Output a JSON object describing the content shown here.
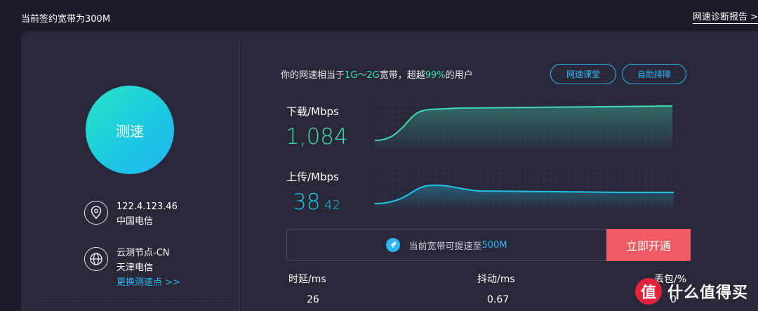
{
  "header": {
    "contract_bandwidth": "当前签约宽带为300M",
    "report_link": "网速诊断报告 >"
  },
  "left": {
    "speed_button": "测速",
    "ip": "122.4.123.46",
    "isp": "中国电信",
    "node_name": "云测节点-CN",
    "node_isp": "天津电信",
    "change_node": "更换测速点 >>"
  },
  "compare": {
    "prefix": "你的网速相当于",
    "range": "1G～2G",
    "mid": "宽带，超越",
    "percent": "99%",
    "suffix": "的用户"
  },
  "buttons": {
    "course": "网速课堂",
    "self_check": "自助排障"
  },
  "download": {
    "label": "下载/Mbps",
    "value": "1,084",
    "color": "#3fdcb2"
  },
  "upload": {
    "label": "上传/Mbps",
    "value_int": "38",
    "value_frac": ".42",
    "color": "#1ec3e6"
  },
  "promo": {
    "text": "当前宽带可提速至",
    "highlight": "500M",
    "button": "立即开通"
  },
  "stats": {
    "latency_label": "时延/ms",
    "latency_value": "26",
    "jitter_label": "抖动/ms",
    "jitter_value": "0.67",
    "loss_label": "丢包/%",
    "loss_value": "0"
  },
  "watermark": {
    "logo": "值",
    "text": "什么值得买"
  },
  "icons": {
    "location": "location-pin-icon",
    "node": "globe-icon",
    "rocket": "rocket-icon"
  }
}
